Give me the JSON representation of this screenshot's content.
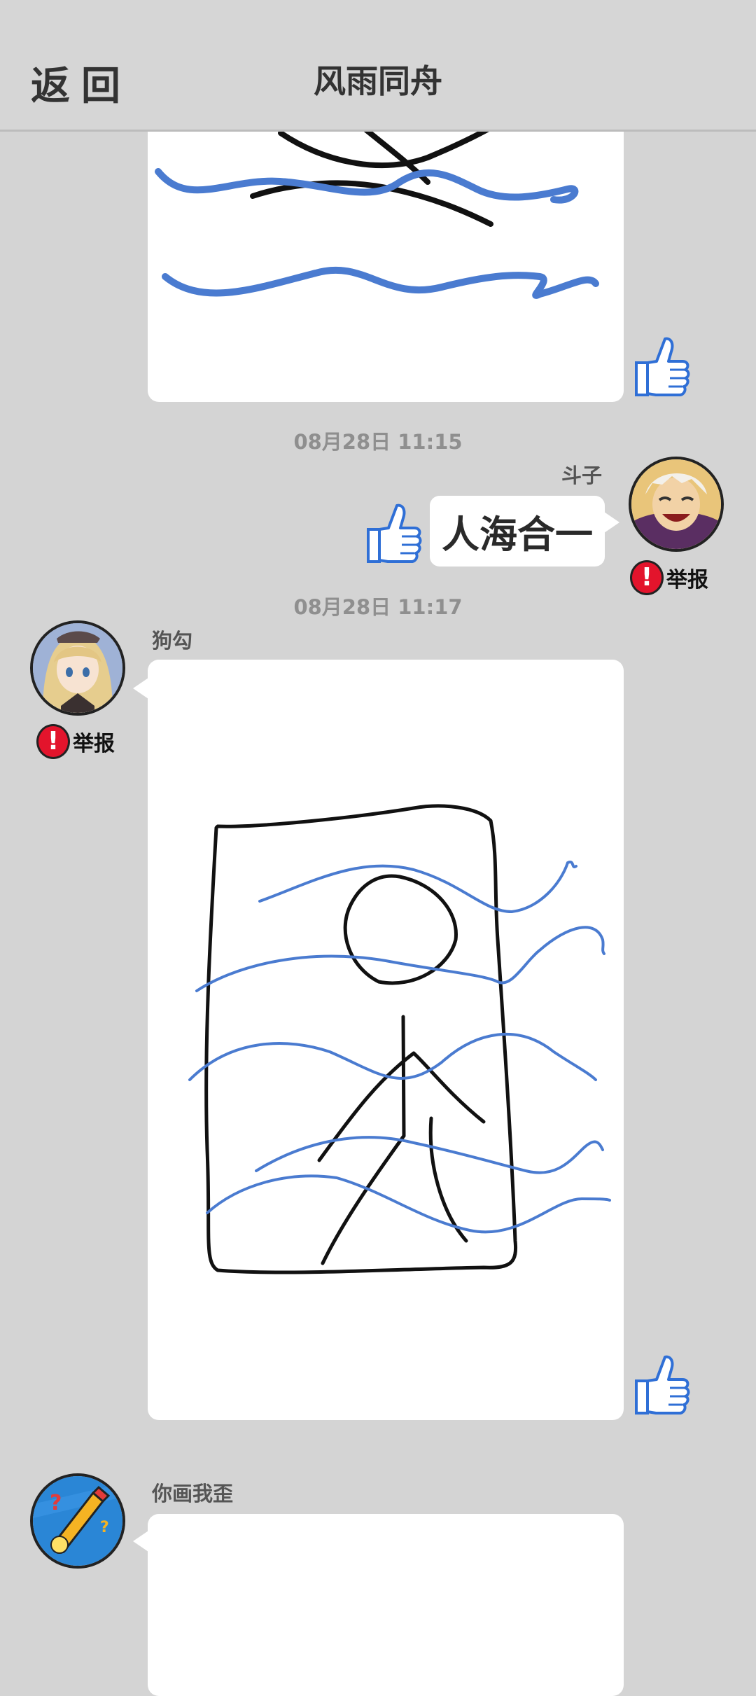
{
  "header": {
    "back_label": "返回",
    "title": "风雨同舟"
  },
  "messages": [
    {
      "type": "drawing",
      "side": "left",
      "partial": "top"
    },
    {
      "time": "08月28日  11:15",
      "type": "text",
      "side": "right",
      "sender": "斗子",
      "text": "人海合一",
      "report_label": "举报"
    },
    {
      "time": "08月28日  11:17",
      "type": "drawing",
      "side": "left",
      "sender": "狗勾",
      "report_label": "举报"
    },
    {
      "type": "drawing",
      "side": "left",
      "sender": "你画我歪",
      "partial": "bottom"
    }
  ],
  "icons": {
    "like": "thumbs-up-icon",
    "report": "exclamation-icon"
  },
  "colors": {
    "background": "#d4d4d4",
    "stroke_blue": "#4a7bd0",
    "stroke_black": "#111111",
    "report_red": "#e3142c",
    "like_blue": "#2f6fd6"
  }
}
